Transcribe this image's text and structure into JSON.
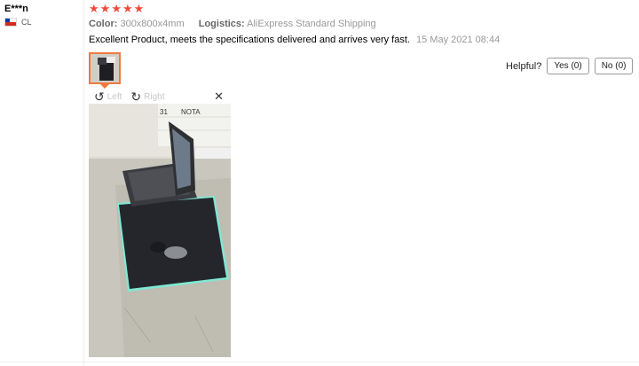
{
  "reviewer": {
    "name": "E***n",
    "country": "CL",
    "flag": "chile-flag"
  },
  "rating": {
    "stars": 5,
    "max": 5,
    "color": "#f04a3a"
  },
  "meta": {
    "color_label": "Color:",
    "color_value": "300x800x4mm",
    "logistics_label": "Logistics:",
    "logistics_value": "AliExpress Standard Shipping"
  },
  "review": {
    "text": "Excellent Product, meets the specifications delivered and arrives very fast.",
    "date": "15 May 2021 08:44"
  },
  "viewer": {
    "rotate_left": "Left",
    "rotate_right": "Right",
    "close": "✕",
    "rotate_left_icon": "↺",
    "rotate_right_icon": "↻"
  },
  "photo": {
    "paper_text_1": "31",
    "paper_text_2": "NOTA",
    "accent_color": "#f07a3c"
  },
  "helpful": {
    "label": "Helpful?",
    "yes": "Yes (0)",
    "no": "No (0)"
  }
}
